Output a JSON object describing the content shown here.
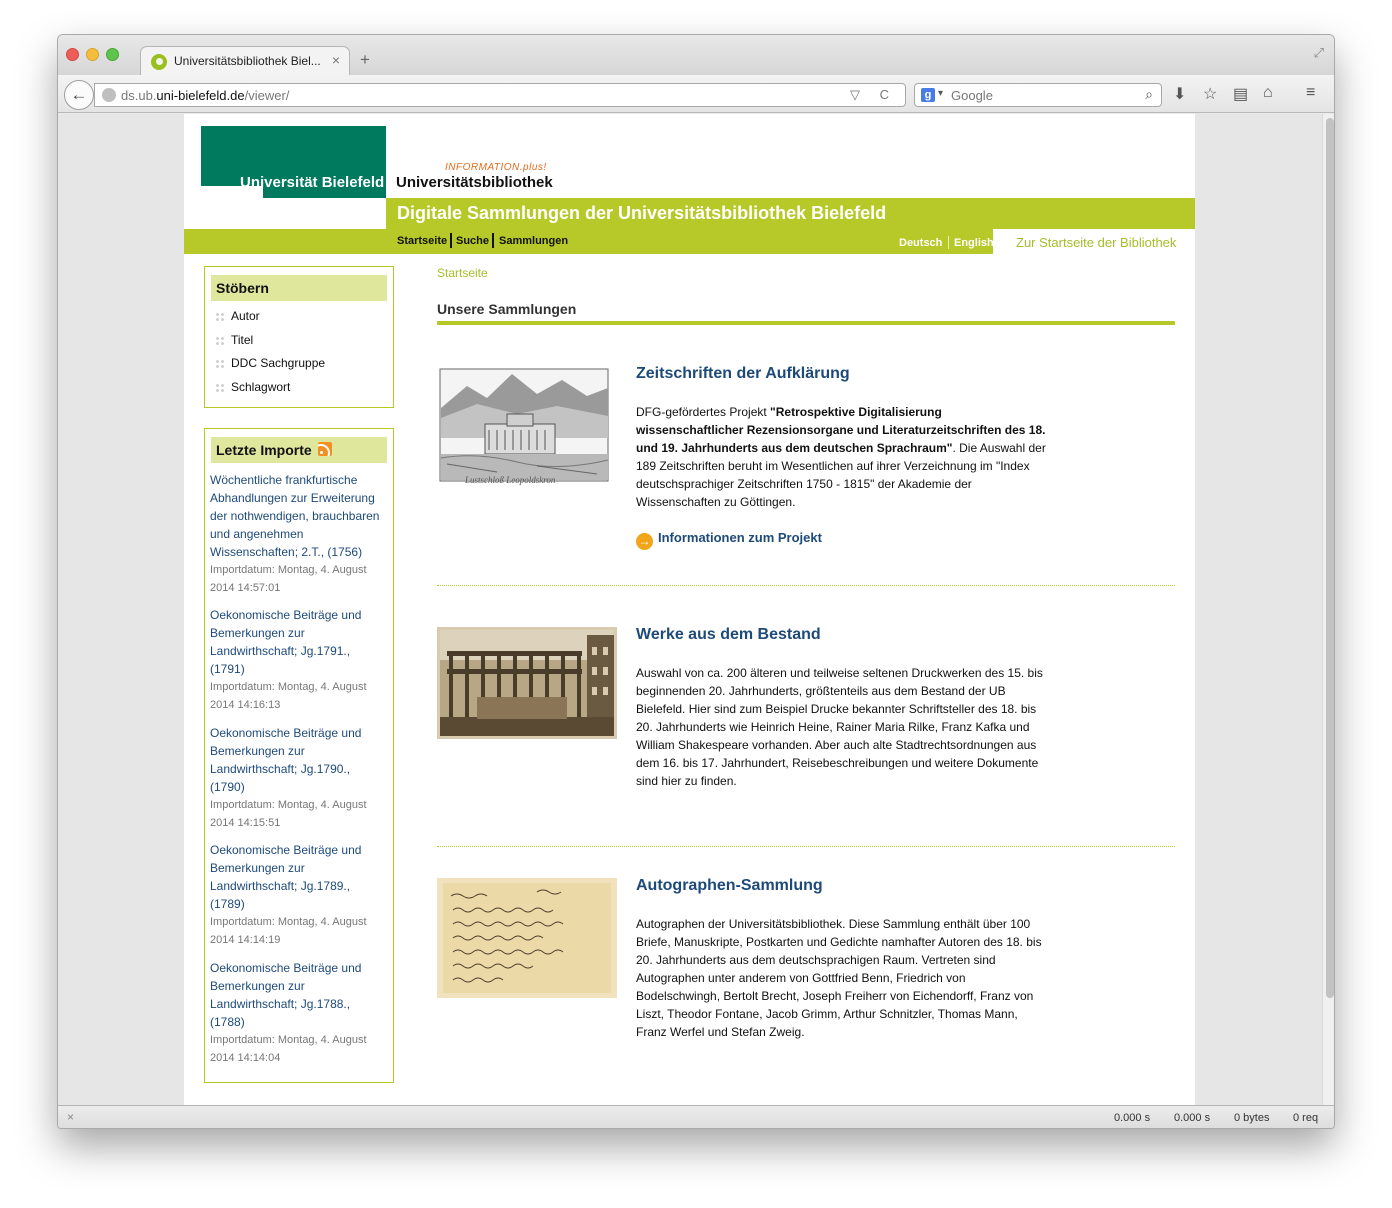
{
  "browser": {
    "tab_title": "Universitätsbibliothek Biel...",
    "tab_close": "×",
    "new_tab": "+",
    "url_host_prefix": "ds.ub.",
    "url_domain": "uni-bielefeld.de",
    "url_path": "/viewer/",
    "url_icons": "▽ C",
    "search_placeholder": "Google",
    "search_engine_glyph": "g",
    "search_dropdown": "▾",
    "icons": [
      "back-arrow-icon",
      "download-icon",
      "bookmark-star-icon",
      "reader-icon",
      "home-icon",
      "menu-icon"
    ],
    "status": {
      "close": "×",
      "time1": "0.000 s",
      "time2": "0.000 s",
      "bytes": "0 bytes",
      "requests": "0 req"
    }
  },
  "header": {
    "uni_logo_text": "Universität Bielefeld",
    "info_plus": "INFORMATION.plus!",
    "library_name": "Universitätsbibliothek",
    "site_title": "Digitale Sammlungen der Universitätsbibliothek Bielefeld",
    "nav": [
      "Startseite",
      "Suche",
      "Sammlungen"
    ],
    "languages": [
      "Deutsch",
      "English"
    ],
    "home_link": "Zur Startseite der Bibliothek"
  },
  "sidebar": {
    "browse": {
      "title": "Stöbern",
      "items": [
        "Autor",
        "Titel",
        "DDC Sachgruppe",
        "Schlagwort"
      ]
    },
    "imports": {
      "title": "Letzte Importe",
      "items": [
        {
          "title_lines": [
            "Wöchentliche frankfurtische",
            "Abhandlungen zur Erweiterung",
            "der nothwendigen, brauchbaren",
            "und angenehmen",
            "Wissenschaften; 2.T., (1756)"
          ],
          "date_lines": [
            "Importdatum: Montag, 4. August",
            "2014 14:57:01"
          ]
        },
        {
          "title_lines": [
            "Oekonomische Beiträge und",
            "Bemerkungen zur",
            "Landwirthschaft; Jg.1791.,",
            "(1791)"
          ],
          "date_lines": [
            "Importdatum: Montag, 4. August",
            "2014 14:16:13"
          ]
        },
        {
          "title_lines": [
            "Oekonomische Beiträge und",
            "Bemerkungen zur",
            "Landwirthschaft; Jg.1790.,",
            "(1790)"
          ],
          "date_lines": [
            "Importdatum: Montag, 4. August",
            "2014 14:15:51"
          ]
        },
        {
          "title_lines": [
            "Oekonomische Beiträge und",
            "Bemerkungen zur",
            "Landwirthschaft; Jg.1789.,",
            "(1789)"
          ],
          "date_lines": [
            "Importdatum: Montag, 4. August",
            "2014 14:14:19"
          ]
        },
        {
          "title_lines": [
            "Oekonomische Beiträge und",
            "Bemerkungen zur",
            "Landwirthschaft; Jg.1788.,",
            "(1788)"
          ],
          "date_lines": [
            "Importdatum: Montag, 4. August",
            "2014 14:14:04"
          ]
        }
      ]
    }
  },
  "main": {
    "breadcrumb": "Startseite",
    "section_title": "Unsere Sammlungen",
    "collections": [
      {
        "title": "Zeitschriften der Aufklärung",
        "desc_lines_html": [
          "DFG-gefördertes Projekt <b>\"Retrospektive Digitalisierung</b>",
          "<b>wissenschaftlicher Rezensionsorgane und Literaturzeitschriften des 18.</b>",
          "<b>und 19. Jahrhunderts aus dem deutschen Sprachraum\"</b>. Die Auswahl der",
          "189 Zeitschriften beruht im Wesentlichen auf ihrer Verzeichnung im \"Index",
          "deutschsprachiger Zeitschriften 1750 - 1815\" der Akademie der",
          "Wissenschaften zu Göttingen."
        ],
        "link": "Informationen zum Projekt",
        "link_arrow": "→",
        "image_caption": "Lustschloß Leopoldskron"
      },
      {
        "title": "Werke aus dem Bestand",
        "desc_lines": [
          "Auswahl von ca. 200 älteren und teilweise seltenen Druckwerken des 15. bis",
          "beginnenden 20. Jahrhunderts, größtenteils aus dem Bestand der UB",
          "Bielefeld. Hier sind zum Beispiel Drucke bekannter Schriftsteller des 18. bis",
          "20. Jahrhunderts wie Heinrich Heine, Rainer Maria Rilke, Franz Kafka und",
          "William Shakespeare vorhanden. Aber auch alte Stadtrechtsordnungen aus",
          "dem 16. bis 17. Jahrhundert, Reisebeschreibungen und weitere Dokumente",
          "sind hier zu finden."
        ]
      },
      {
        "title": "Autographen-Sammlung",
        "desc_lines": [
          "Autographen der Universitätsbibliothek. Diese Sammlung enthält über 100",
          "Briefe, Manuskripte, Postkarten und Gedichte namhafter Autoren des 18. bis",
          "20. Jahrhunderts aus dem deutschsprachigen Raum. Vertreten sind",
          "Autographen unter anderem von Gottfried Benn, Friedrich von",
          "Bodelschwingh, Bertolt Brecht, Joseph Freiherr von Eichendorff, Franz von",
          "Liszt, Theodor Fontane, Jacob Grimm, Arthur Schnitzler, Thomas Mann,",
          "Franz Werfel und Stefan Zweig."
        ]
      }
    ]
  },
  "colors": {
    "accent_green": "#b7c928",
    "uni_green": "#007a5e",
    "link_blue": "#1e4a7a",
    "orange": "#e26b1c"
  }
}
